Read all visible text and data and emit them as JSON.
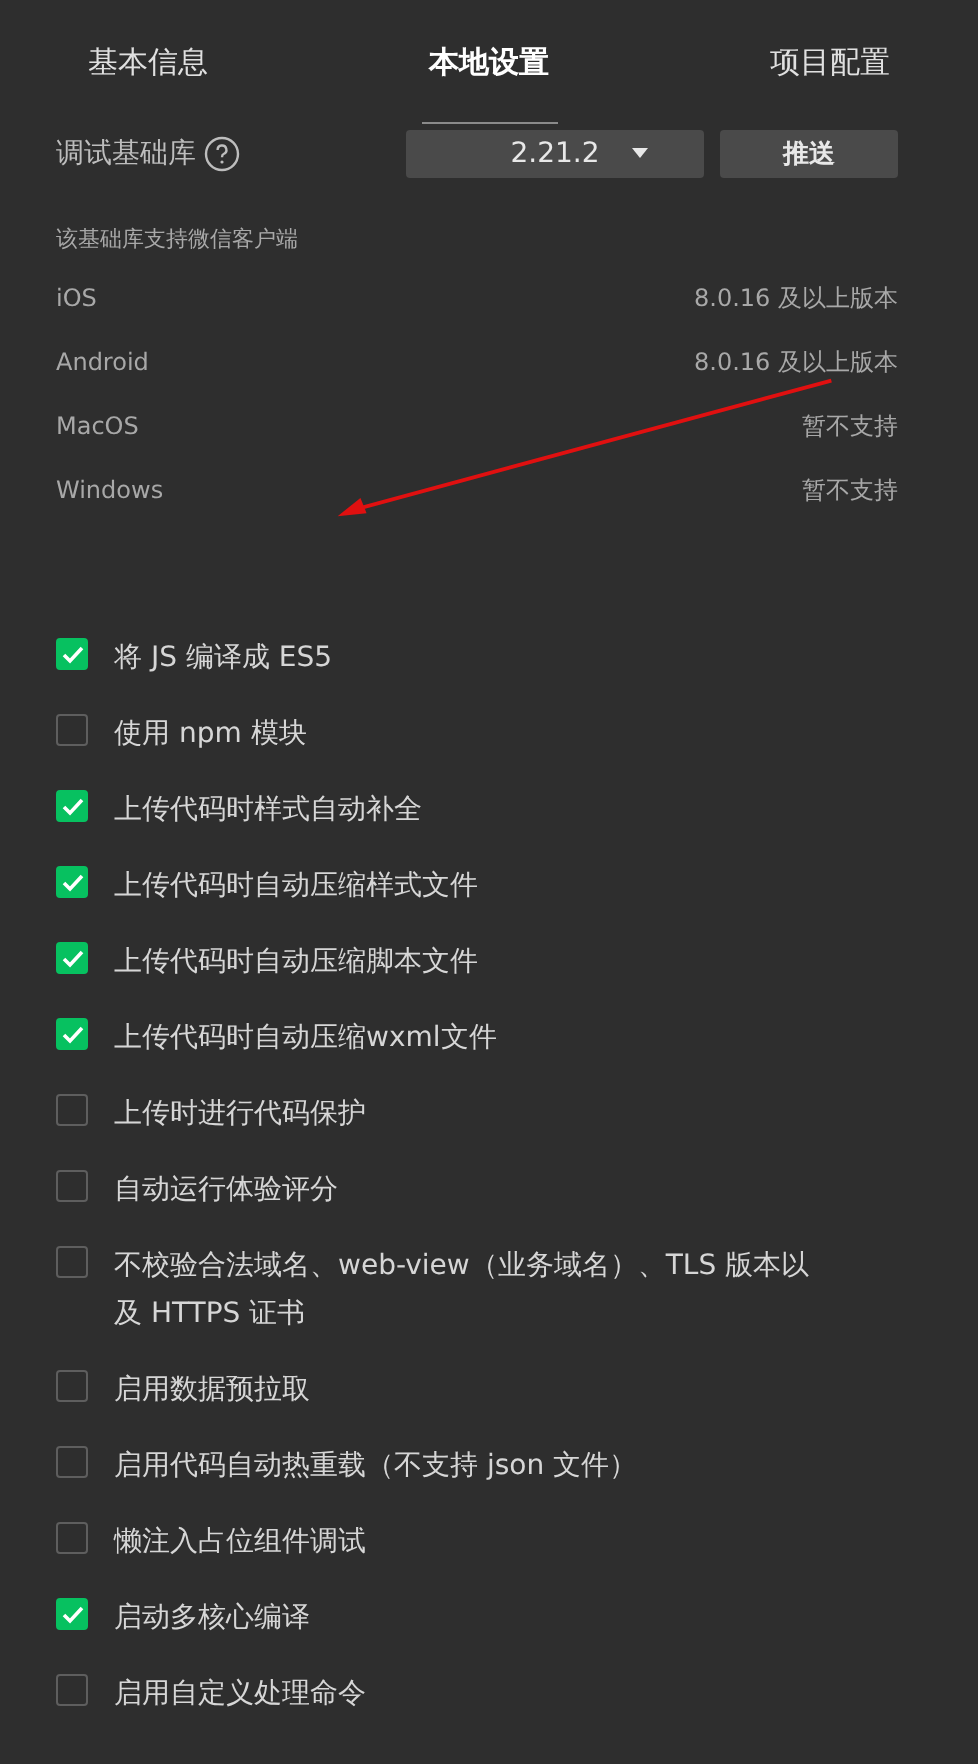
{
  "tabs": [
    {
      "label": "基本信息",
      "selected": false
    },
    {
      "label": "本地设置",
      "selected": true
    },
    {
      "label": "项目配置",
      "selected": false
    }
  ],
  "base_library": {
    "label": "调试基础库",
    "version": "2.21.2",
    "push_button": "推送"
  },
  "support": {
    "title": "该基础库支持微信客户端",
    "rows": [
      {
        "platform": "iOS",
        "requirement": "8.0.16 及以上版本"
      },
      {
        "platform": "Android",
        "requirement": "8.0.16 及以上版本"
      },
      {
        "platform": "MacOS",
        "requirement": "暂不支持"
      },
      {
        "platform": "Windows",
        "requirement": "暂不支持"
      }
    ]
  },
  "options": [
    {
      "label": "将 JS 编译成 ES5",
      "checked": true
    },
    {
      "label": "使用 npm 模块",
      "checked": false
    },
    {
      "label": "上传代码时样式自动补全",
      "checked": true
    },
    {
      "label": "上传代码时自动压缩样式文件",
      "checked": true
    },
    {
      "label": "上传代码时自动压缩脚本文件",
      "checked": true
    },
    {
      "label": "上传代码时自动压缩wxml文件",
      "checked": true
    },
    {
      "label": "上传时进行代码保护",
      "checked": false
    },
    {
      "label": "自动运行体验评分",
      "checked": false
    },
    {
      "label": "不校验合法域名、web-view（业务域名）、TLS 版本以及 HTTPS 证书",
      "checked": false
    },
    {
      "label": "启用数据预拉取",
      "checked": false
    },
    {
      "label": "启用代码自动热重载（不支持 json 文件）",
      "checked": false
    },
    {
      "label": "懒注入占位组件调试",
      "checked": false
    },
    {
      "label": "启动多核心编译",
      "checked": true
    },
    {
      "label": "启用自定义处理命令",
      "checked": false
    }
  ]
}
